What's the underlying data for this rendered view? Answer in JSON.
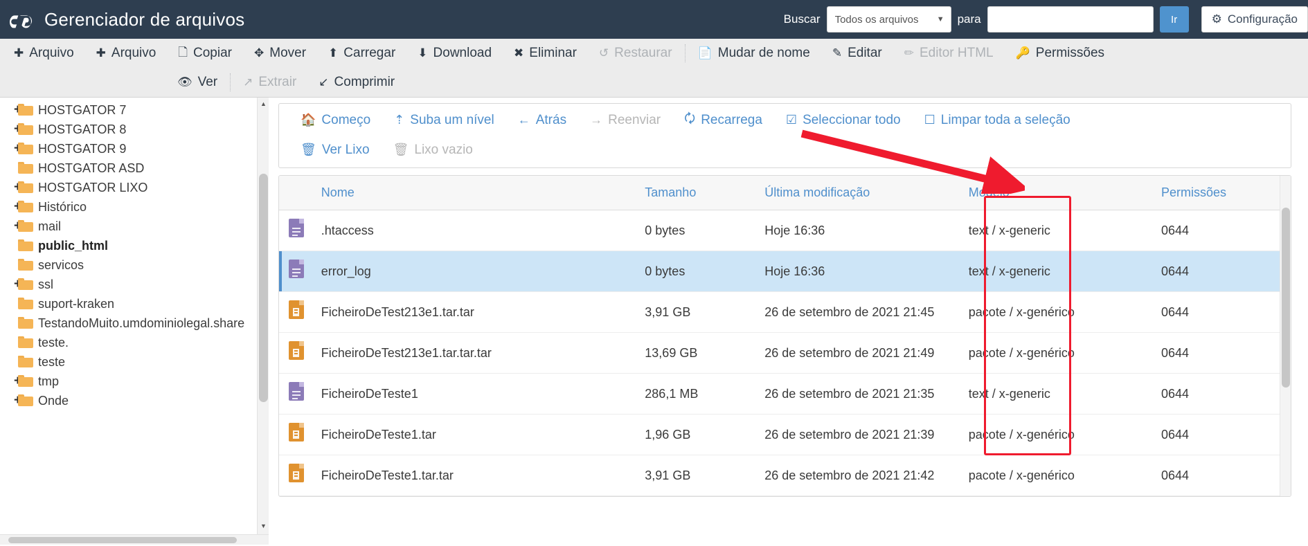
{
  "header": {
    "logo_icon": "cpanel-logo",
    "title": "Gerenciador de arquivos",
    "search_label": "Buscar",
    "search_scope_value": "Todos os arquivos",
    "search_scope_options": [
      "Todos os arquivos"
    ],
    "search_for_label": "para",
    "search_input_value": "",
    "search_input_placeholder": "",
    "go_button": "Ir",
    "settings_button": "Configuração",
    "settings_icon": "gear-icon",
    "brand_color": "#2e3e50",
    "accent_color": "#4f93ce"
  },
  "toolbar": {
    "row1": [
      {
        "label": "Arquivo",
        "icon": "plus-icon",
        "disabled": false
      },
      {
        "label": "Arquivo",
        "icon": "plus-icon",
        "disabled": false
      },
      {
        "label": "Copiar",
        "icon": "copy-icon",
        "disabled": false
      },
      {
        "label": "Mover",
        "icon": "move-icon",
        "disabled": false
      },
      {
        "label": "Carregar",
        "icon": "upload-icon",
        "disabled": false
      },
      {
        "label": "Download",
        "icon": "download-icon",
        "disabled": false
      },
      {
        "label": "Eliminar",
        "icon": "close-x-icon",
        "disabled": false
      },
      {
        "label": "Restaurar",
        "icon": "undo-icon",
        "disabled": true
      },
      {
        "label": "Mudar de nome",
        "icon": "file-icon",
        "disabled": false
      },
      {
        "label": "Editar",
        "icon": "pencil-icon",
        "disabled": false
      },
      {
        "label": "Editor HTML",
        "icon": "edit-square-icon",
        "disabled": true
      },
      {
        "label": "Permissões",
        "icon": "key-icon",
        "disabled": false
      }
    ],
    "row2": [
      {
        "label": "Ver",
        "icon": "eye-icon",
        "disabled": false
      },
      {
        "label": "Extrair",
        "icon": "extract-arrow-icon",
        "disabled": true
      },
      {
        "label": "Comprimir",
        "icon": "compress-arrow-icon",
        "disabled": false
      }
    ]
  },
  "navbar": {
    "row1": [
      {
        "label": "Começo",
        "icon": "home-icon",
        "disabled": false
      },
      {
        "label": "Suba um nível",
        "icon": "arrow-up-level-icon",
        "disabled": false
      },
      {
        "label": "Atrás",
        "icon": "arrow-left-icon",
        "disabled": false
      },
      {
        "label": "Reenviar",
        "icon": "arrow-right-icon",
        "disabled": true
      },
      {
        "label": "Recarrega",
        "icon": "refresh-icon",
        "disabled": false
      },
      {
        "label": "Seleccionar todo",
        "icon": "checkbox-checked-icon",
        "disabled": false
      },
      {
        "label": "Limpar toda a seleção",
        "icon": "checkbox-empty-icon",
        "disabled": false
      }
    ],
    "row2": [
      {
        "label": "Ver Lixo",
        "icon": "trash-icon",
        "disabled": false
      },
      {
        "label": "Lixo vazio",
        "icon": "trash-icon",
        "disabled": true
      }
    ]
  },
  "sidebar": {
    "items": [
      {
        "label": "HOSTGATOR 7",
        "expandable": true,
        "current": false
      },
      {
        "label": "HOSTGATOR 8",
        "expandable": true,
        "current": false
      },
      {
        "label": "HOSTGATOR 9",
        "expandable": true,
        "current": false
      },
      {
        "label": "HOSTGATOR ASD",
        "expandable": false,
        "current": false
      },
      {
        "label": "HOSTGATOR LIXO",
        "expandable": true,
        "current": false
      },
      {
        "label": "Histórico",
        "expandable": true,
        "current": false
      },
      {
        "label": "mail",
        "expandable": true,
        "current": false
      },
      {
        "label": "public_html",
        "expandable": false,
        "current": true
      },
      {
        "label": "servicos",
        "expandable": false,
        "current": false
      },
      {
        "label": "ssl",
        "expandable": true,
        "current": false
      },
      {
        "label": "suport-kraken",
        "expandable": false,
        "current": false
      },
      {
        "label": "TestandoMuito.umdominiolegal.share",
        "expandable": false,
        "current": false
      },
      {
        "label": "teste.",
        "expandable": false,
        "current": false
      },
      {
        "label": "teste",
        "expandable": false,
        "current": false
      },
      {
        "label": "tmp",
        "expandable": true,
        "current": false
      },
      {
        "label": "Onde",
        "expandable": true,
        "current": false
      }
    ]
  },
  "table": {
    "columns": [
      "Nome",
      "Tamanho",
      "Última modificação",
      "Modelo",
      "Permissões"
    ],
    "rows": [
      {
        "icon": "text-file-icon",
        "name": ".htaccess",
        "size": "0 bytes",
        "modified": "Hoje 16:36",
        "type": "text / x-generic",
        "permissions": "0644",
        "selected": false
      },
      {
        "icon": "text-file-icon",
        "name": "error_log",
        "size": "0 bytes",
        "modified": "Hoje 16:36",
        "type": "text / x-generic",
        "permissions": "0644",
        "selected": true
      },
      {
        "icon": "archive-file-icon",
        "name": "FicheiroDeTest213e1.tar.tar",
        "size": "3,91 GB",
        "modified": "26 de setembro de 2021 21:45",
        "type": "pacote / x-genérico",
        "permissions": "0644",
        "selected": false
      },
      {
        "icon": "archive-file-icon",
        "name": "FicheiroDeTest213e1.tar.tar.tar",
        "size": "13,69 GB",
        "modified": "26 de setembro de 2021 21:49",
        "type": "pacote / x-genérico",
        "permissions": "0644",
        "selected": false
      },
      {
        "icon": "text-file-icon",
        "name": "FicheiroDeTeste1",
        "size": "286,1 MB",
        "modified": "26 de setembro de 2021 21:35",
        "type": "text / x-generic",
        "permissions": "0644",
        "selected": false
      },
      {
        "icon": "archive-file-icon",
        "name": "FicheiroDeTeste1.tar",
        "size": "1,96 GB",
        "modified": "26 de setembro de 2021 21:39",
        "type": "pacote / x-genérico",
        "permissions": "0644",
        "selected": false
      },
      {
        "icon": "archive-file-icon",
        "name": "FicheiroDeTeste1.tar.tar",
        "size": "3,91 GB",
        "modified": "26 de setembro de 2021 21:42",
        "type": "pacote / x-genérico",
        "permissions": "0644",
        "selected": false
      }
    ]
  },
  "annotation": {
    "shape": "red-rectangle-and-arrow",
    "color": "#ef1b2e",
    "target_column": "Permissões"
  }
}
